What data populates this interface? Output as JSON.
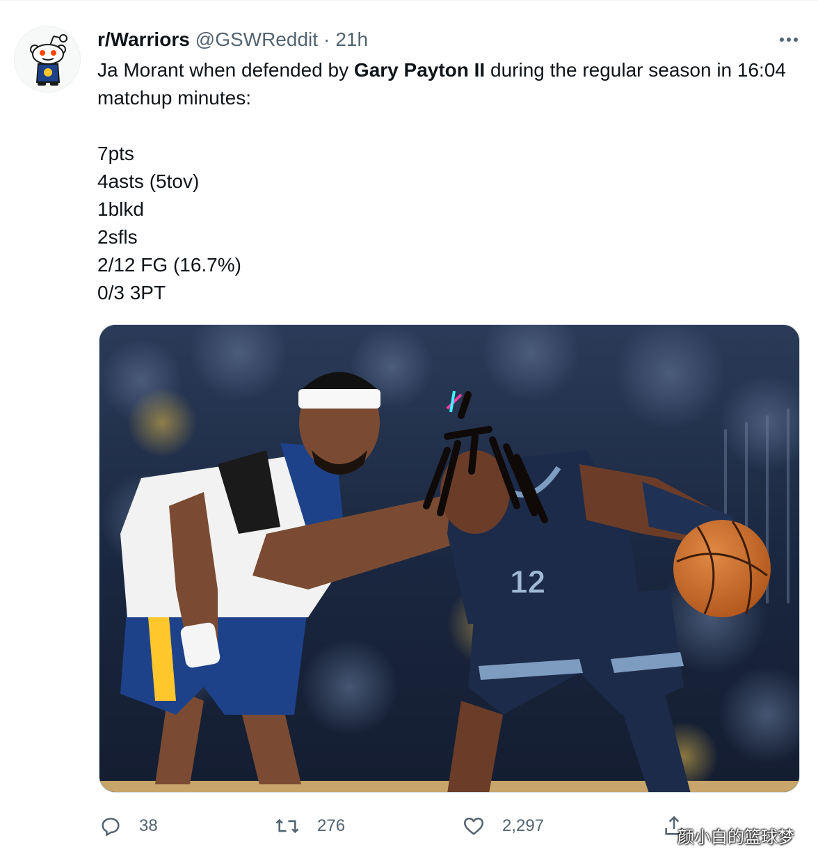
{
  "tweet": {
    "display_name": "r/Warriors",
    "handle": "@GSWReddit",
    "separator": "·",
    "time": "21h",
    "text_part1": "Ja Morant when defended by ",
    "text_bold": "Gary Payton II",
    "text_part2": " during the regular season in 16:04 matchup minutes:",
    "stats": [
      "7pts",
      "4asts (5tov)",
      "1blkd",
      "2sfls",
      "2/12 FG (16.7%)",
      "0/3 3PT"
    ]
  },
  "media": {
    "front_jersey_number": "12"
  },
  "actions": {
    "replies": "38",
    "retweets": "276",
    "likes": "2,297"
  },
  "watermark": "颜小白的篮球梦",
  "icons": {
    "avatar": "reddit-snoo-warriors-icon",
    "more": "more-options-icon",
    "reply": "reply-icon",
    "retweet": "retweet-icon",
    "like": "heart-icon",
    "share": "share-icon"
  },
  "colors": {
    "text": "#0f1419",
    "secondary": "#536471",
    "warriors_blue": "#1d428a",
    "grizzlies_navy": "#1d2b4a"
  }
}
